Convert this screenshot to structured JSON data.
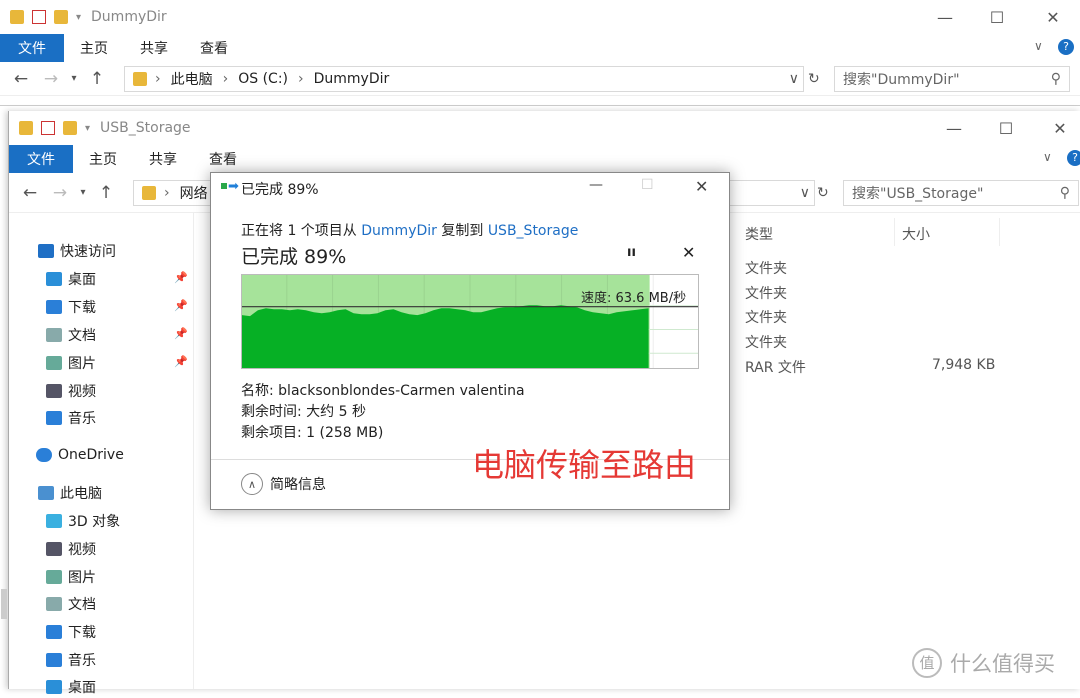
{
  "back_window": {
    "title": "DummyDir",
    "tabs": [
      "文件",
      "主页",
      "共享",
      "查看"
    ],
    "breadcrumb": [
      "此电脑",
      "OS (C:)",
      "DummyDir"
    ],
    "search_placeholder": "搜索\"DummyDir\""
  },
  "front_window": {
    "title": "USB_Storage",
    "tabs": [
      "文件",
      "主页",
      "共享",
      "查看"
    ],
    "breadcrumb": [
      "网络"
    ],
    "search_placeholder": "搜索\"USB_Storage\"",
    "nav": [
      {
        "label": "快速访问",
        "icon": "star-icon",
        "color": "#1f6fc5"
      },
      {
        "label": "桌面",
        "icon": "desktop-icon",
        "color": "#2a8fd8",
        "pinned": true
      },
      {
        "label": "下载",
        "icon": "download-icon",
        "color": "#2a7fd8",
        "pinned": true
      },
      {
        "label": "文档",
        "icon": "document-icon",
        "color": "#8aa",
        "pinned": true
      },
      {
        "label": "图片",
        "icon": "pictures-icon",
        "color": "#6a9",
        "pinned": true
      },
      {
        "label": "视频",
        "icon": "video-icon",
        "color": "#556"
      },
      {
        "label": "音乐",
        "icon": "music-icon",
        "color": "#2a7fd8"
      },
      {
        "label": "OneDrive",
        "icon": "cloud-icon",
        "color": "#2a7fd8"
      },
      {
        "label": "此电脑",
        "icon": "computer-icon",
        "color": "#4a90d0"
      },
      {
        "label": "3D 对象",
        "icon": "cube-icon",
        "color": "#3ab0e0"
      },
      {
        "label": "视频",
        "icon": "video-icon",
        "color": "#556"
      },
      {
        "label": "图片",
        "icon": "pictures-icon",
        "color": "#6a9"
      },
      {
        "label": "文档",
        "icon": "document-icon",
        "color": "#8aa"
      },
      {
        "label": "下载",
        "icon": "download-icon",
        "color": "#2a7fd8"
      },
      {
        "label": "音乐",
        "icon": "music-icon",
        "color": "#2a7fd8"
      },
      {
        "label": "桌面",
        "icon": "desktop-icon",
        "color": "#2a8fd8"
      }
    ],
    "columns": [
      "类型",
      "大小"
    ],
    "rows": [
      {
        "type": "文件夹",
        "size": ""
      },
      {
        "type": "文件夹",
        "size": ""
      },
      {
        "type": "文件夹",
        "size": ""
      },
      {
        "type": "文件夹",
        "size": ""
      },
      {
        "type": "RAR 文件",
        "size": "7,948 KB"
      }
    ]
  },
  "dialog": {
    "title": "已完成 89%",
    "desc_prefix": "正在将 1 个项目从 ",
    "source": "DummyDir",
    "desc_mid": " 复制到 ",
    "dest": "USB_Storage",
    "progress_label": "已完成 89%",
    "progress": 0.89,
    "speed": "速度: 63.6 MB/秒",
    "speed_value": 63.6,
    "speed_history": [
      55,
      54,
      60,
      62,
      61,
      61,
      60,
      61,
      60,
      58,
      57,
      58,
      60,
      61,
      57,
      56,
      56,
      57,
      60,
      61,
      58,
      56,
      55,
      57,
      60,
      62,
      62,
      61,
      60,
      58,
      58,
      60,
      62,
      63,
      63,
      64,
      65,
      65,
      64,
      64,
      65,
      64,
      63,
      60,
      58,
      57,
      56,
      58,
      59,
      60,
      61,
      62
    ],
    "name_label": "名称: ",
    "name": "blacksonblondes-Carmen valentina",
    "time_label": "剩余时间: ",
    "time": "大约 5 秒",
    "items_label": "剩余项目: ",
    "items": "1 (258 MB)",
    "details": "简略信息",
    "accent": "#06b025",
    "fill_light": "#a6e39a"
  },
  "annotation": {
    "text": "电脑传输至路由",
    "color": "#e53935"
  },
  "watermark": "什么值得买"
}
